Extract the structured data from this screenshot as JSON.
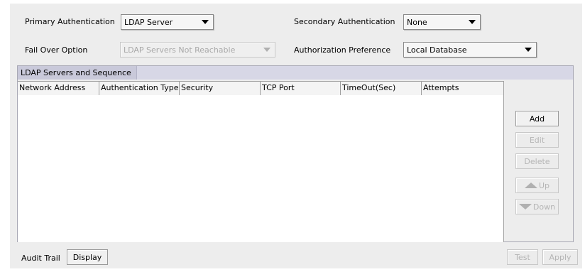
{
  "auth": {
    "primary_label": "Primary Authentication",
    "primary_value": "LDAP Server",
    "secondary_label": "Secondary Authentication",
    "secondary_value": "None",
    "failover_label": "Fail Over Option",
    "failover_value": "LDAP Servers Not Reachable",
    "authz_label": "Authorization Preference",
    "authz_value": "Local Database"
  },
  "servers_panel": {
    "title": "LDAP Servers and Sequence",
    "columns": [
      "Network Address",
      "Authentication Type",
      "Security",
      "TCP Port",
      "TimeOut(Sec)",
      "Attempts"
    ],
    "rows": []
  },
  "side_buttons": {
    "add": "Add",
    "edit": "Edit",
    "delete": "Delete",
    "up": "Up",
    "down": "Down"
  },
  "footer": {
    "audit_label": "Audit Trail",
    "display_button": "Display",
    "test_button": "Test",
    "apply_button": "Apply"
  },
  "icons": {
    "dropdown": "chevron-down-icon",
    "up": "arrow-up-icon",
    "down": "arrow-down-icon"
  }
}
